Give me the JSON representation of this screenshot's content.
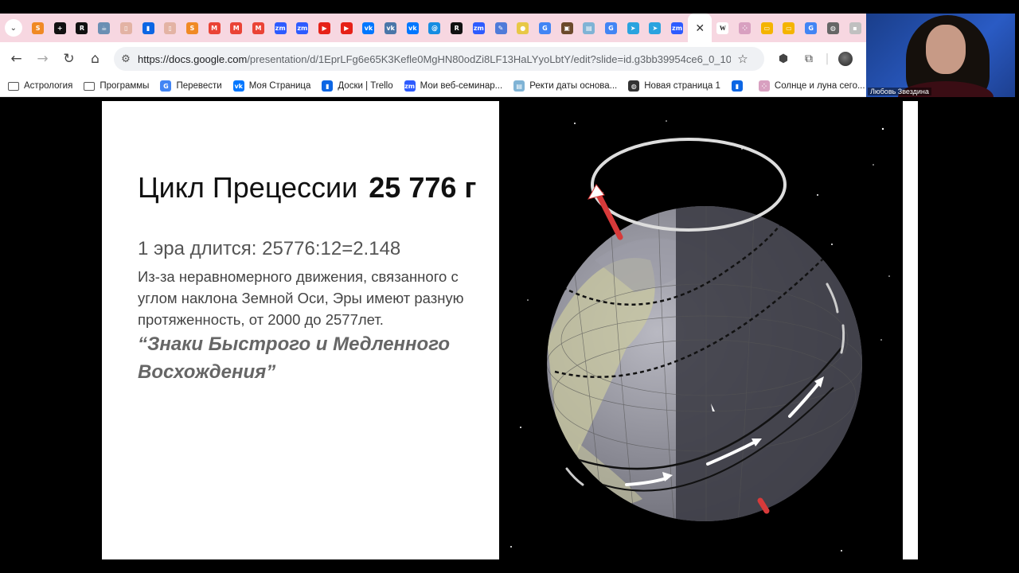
{
  "browser": {
    "tabs": [
      {
        "icon": "chevron-down-icon"
      },
      {
        "icon": "s-app-icon",
        "color": "#f08a24",
        "glyph": "S"
      },
      {
        "icon": "plus-app-icon",
        "color": "#111111",
        "glyph": "+"
      },
      {
        "icon": "r-app-icon",
        "color": "#111111",
        "glyph": "R"
      },
      {
        "icon": "teapot-icon",
        "color": "#6b8fb3",
        "glyph": "☕"
      },
      {
        "icon": "book-icon",
        "color": "#e3b3a4",
        "glyph": "▯"
      },
      {
        "icon": "trello-icon",
        "color": "#0c66e4",
        "glyph": "▮"
      },
      {
        "icon": "book-icon",
        "color": "#e3b3a4",
        "glyph": "▯"
      },
      {
        "icon": "s-app-icon",
        "color": "#f08a24",
        "glyph": "S"
      },
      {
        "icon": "gmail-icon",
        "color": "#ea4335",
        "glyph": "M"
      },
      {
        "icon": "gmail-icon",
        "color": "#ea4335",
        "glyph": "M"
      },
      {
        "icon": "gmail-icon",
        "color": "#ea4335",
        "glyph": "M"
      },
      {
        "icon": "zoom-icon",
        "color": "#2d5bff",
        "glyph": "zm"
      },
      {
        "icon": "zoom-icon",
        "color": "#2d5bff",
        "glyph": "zm"
      },
      {
        "icon": "youtube-icon",
        "color": "#e62117",
        "glyph": "▶"
      },
      {
        "icon": "youtube-icon",
        "color": "#e62117",
        "glyph": "▶"
      },
      {
        "icon": "vk-icon",
        "color": "#0077ff",
        "glyph": "vk"
      },
      {
        "icon": "vk-circle-icon",
        "color": "#4a76a8",
        "glyph": "vk"
      },
      {
        "icon": "vk-icon",
        "color": "#0077ff",
        "glyph": "vk"
      },
      {
        "icon": "at-sign-icon",
        "color": "#168de2",
        "glyph": "@"
      },
      {
        "icon": "r-app-icon",
        "color": "#111111",
        "glyph": "R"
      },
      {
        "icon": "zoom-icon",
        "color": "#2d5bff",
        "glyph": "zm"
      },
      {
        "icon": "feather-icon",
        "color": "#4f7bd9",
        "glyph": "✎"
      },
      {
        "icon": "lemon-icon",
        "color": "#e8c846",
        "glyph": "●"
      },
      {
        "icon": "google-icon",
        "color": "#4285f4",
        "glyph": "G"
      },
      {
        "icon": "portrait-icon",
        "color": "#6b4a2b",
        "glyph": "▣"
      },
      {
        "icon": "bookmark-chart-icon",
        "color": "#7fb3d5",
        "glyph": "▤"
      },
      {
        "icon": "google-icon",
        "color": "#4285f4",
        "glyph": "G"
      },
      {
        "icon": "telegram-icon",
        "color": "#2aa3df",
        "glyph": "➤"
      },
      {
        "icon": "telegram-icon",
        "color": "#2aa3df",
        "glyph": "➤"
      },
      {
        "icon": "zoom-icon",
        "color": "#2d5bff",
        "glyph": "zm"
      },
      {
        "icon": "close-icon",
        "active": true,
        "glyph": "✕"
      },
      {
        "icon": "wikipedia-icon",
        "color": "#ffffff",
        "glyph": "W"
      },
      {
        "icon": "dots-icon",
        "color": "#d8a0c0",
        "glyph": "⁘"
      },
      {
        "icon": "slides-icon",
        "color": "#f4b400",
        "glyph": "▭"
      },
      {
        "icon": "slides-icon",
        "color": "#f4b400",
        "glyph": "▭"
      },
      {
        "icon": "google-icon",
        "color": "#4285f4",
        "glyph": "G"
      },
      {
        "icon": "globe-icon",
        "color": "#666666",
        "glyph": "◍"
      },
      {
        "icon": "app-icon",
        "color": "#c0c0c0",
        "glyph": "▪"
      }
    ],
    "address": {
      "host": "https://docs.google.com",
      "path": "/presentation/d/1EprLFg6e65K3Kefle0MgHN80odZi8LF13HaLYyoLbtY/edit?slide=id.g3bb39954ce6_0_1032..."
    },
    "bookmarks": [
      {
        "label": "Астрология",
        "icon": "folder-icon",
        "color": ""
      },
      {
        "label": "Программы",
        "icon": "folder-icon",
        "color": ""
      },
      {
        "label": "Перевести",
        "icon": "translate-icon",
        "color": "#4285f4",
        "glyph": "G"
      },
      {
        "label": "Моя Страница",
        "icon": "vk-icon",
        "color": "#0077ff",
        "glyph": "vk"
      },
      {
        "label": "Доски | Trello",
        "icon": "trello-icon",
        "color": "#0c66e4",
        "glyph": "▮"
      },
      {
        "label": "Мои веб-семинар...",
        "icon": "zoom-icon",
        "color": "#2d5bff",
        "glyph": "zm"
      },
      {
        "label": "Ректи даты основа...",
        "icon": "chart-icon",
        "color": "#7fb3d5",
        "glyph": "▤"
      },
      {
        "label": "Новая страница 1",
        "icon": "globe-icon",
        "color": "#333333",
        "glyph": "◍"
      },
      {
        "label": "",
        "icon": "trello-icon",
        "color": "#0c66e4",
        "glyph": "▮"
      },
      {
        "label": "Солнце и луна сего...",
        "icon": "sun-moon-icon",
        "color": "#d8a0c0",
        "glyph": "⁘"
      }
    ]
  },
  "webcam": {
    "name": "Любовь Звездина"
  },
  "slide": {
    "title": "Цикл Прецессии",
    "title_bold": "25 776 г",
    "era": "1 эра длится: 25776:12=2.148",
    "body": "Из-за неравномерного движения, связанного с углом наклона Земной Оси, Эры имеют разную протяженность, от 2000 до 2577лет.",
    "quote_line1": "“Знаки Быстрого и Медленного",
    "quote_line2": "Восхождения”"
  },
  "colors": {
    "tabstrip": "#f7d7e1",
    "axis": "#d73a3a",
    "space": "#000000"
  }
}
